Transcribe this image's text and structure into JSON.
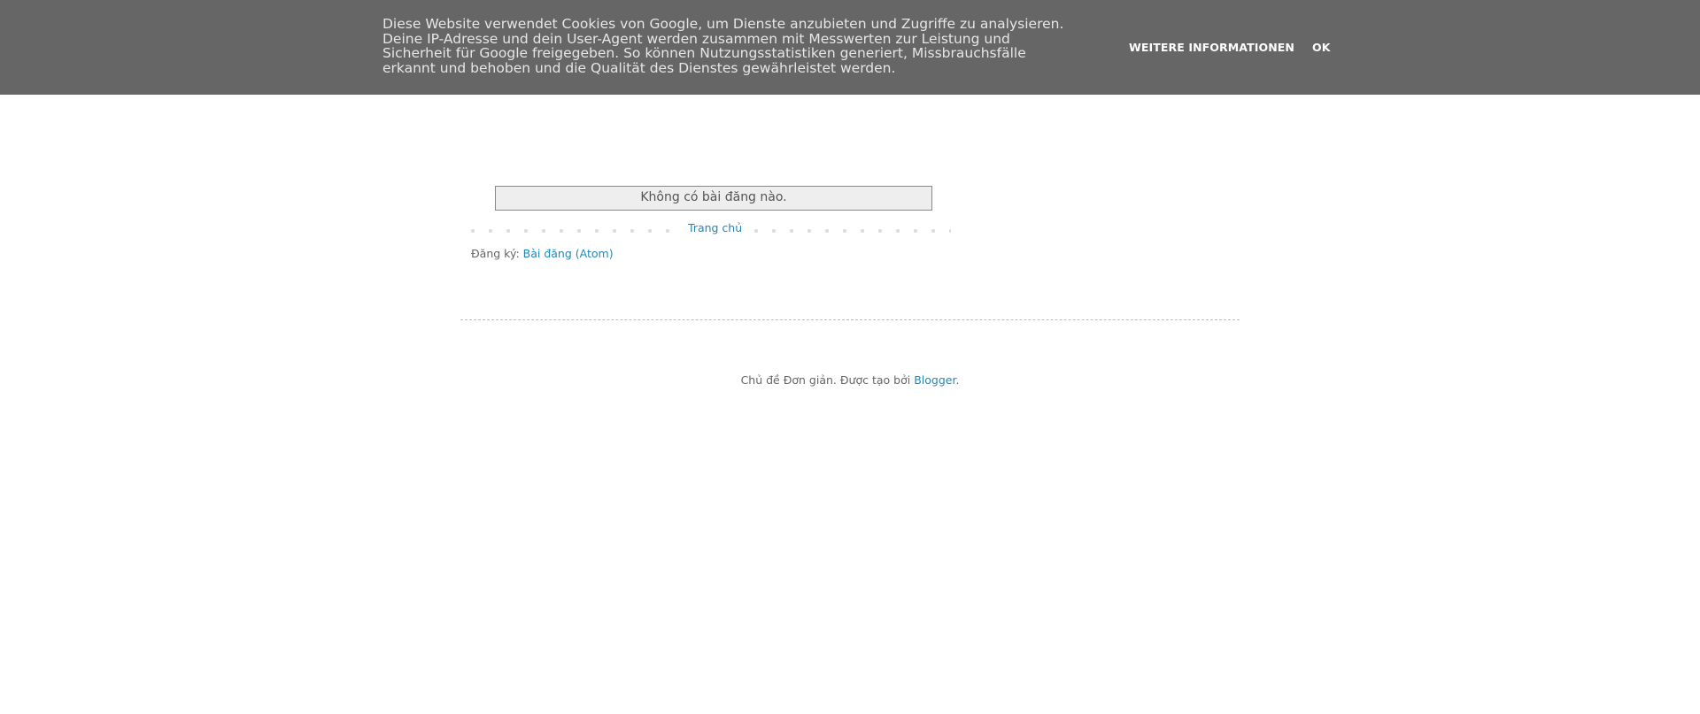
{
  "cookie_notice": {
    "lines": [
      "Diese Website verwendet Cookies von Google, um Dienste anzubieten und Zugriffe zu analysieren.",
      "Deine IP-Adresse und dein User-Agent werden zusammen mit Messwerten zur Leistung und",
      "Sicherheit für Google freigegeben. So können Nutzungsstatistiken generiert, Missbrauchsfälle",
      "erkannt und behoben und die Qualität des Dienstes gewährleistet werden."
    ],
    "more_info_label": "WEITERE INFORMATIONEN",
    "ok_label": "OK"
  },
  "main": {
    "status_message": "Không có bài đăng nào.",
    "pager_home_label": "Trang chủ",
    "feed_label": "Đăng ký:",
    "feed_link_label": "Bài đăng (Atom)"
  },
  "footer": {
    "attribution_text": "Chủ đề Đơn giản. Được tạo bởi ",
    "attribution_link": "Blogger",
    "attribution_end": "."
  },
  "colors": {
    "cookie_bar_bg": "#666666",
    "link": "#2288bb",
    "text": "#666666"
  }
}
